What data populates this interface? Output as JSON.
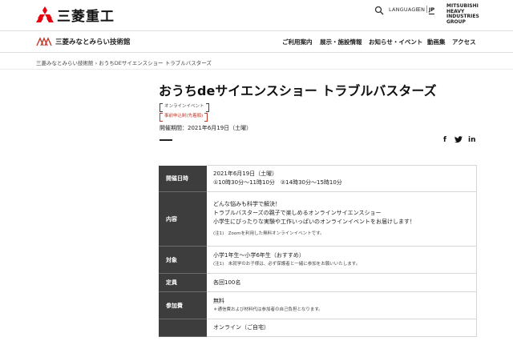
{
  "header": {
    "brand": "三菱重工",
    "language_label": "LANGUAGE :",
    "lang_en": "EN",
    "lang_jp": "JP",
    "group_logo": [
      "MITSUBISHI",
      "HEAVY",
      "INDUSTRIES",
      "GROUP"
    ]
  },
  "nav": {
    "site_name": "三菱みなとみらい技術館",
    "items": [
      "ご利用案内",
      "展示・施設情報",
      "お知らせ・イベント",
      "動画集",
      "アクセス"
    ]
  },
  "breadcrumb": "三菱みなとみらい技術館 › おうちDEサイエンスショー トラブルバスターズ",
  "event": {
    "title": "おうちdeサイエンスショー トラブルバスターズ",
    "tag_online": "オンラインイベント",
    "tag_reserve": "事前申込制(先着順)",
    "period": "開催期間：2021年6月19日（土曜）"
  },
  "share": {
    "facebook": "f",
    "twitter": "t",
    "linkedin": "in"
  },
  "table": {
    "rows": [
      {
        "label": "開催日時",
        "lines": [
          "2021年6月19日（土曜）",
          "①10時30分～11時10分　②14時30分～15時10分"
        ]
      },
      {
        "label": "内容",
        "lines": [
          "どんな悩みも科学で解決！",
          "トラブルバスターズの親子で楽しめるオンラインサイエンスショー",
          "小学生にぴったりな実験や工作いっぱいのオンラインイベントをお届けします！"
        ],
        "note": "(注1)　Zoomを利用した無料オンラインイベントです。"
      },
      {
        "label": "対象",
        "lines": [
          "小学1年生～小学6年生（おすすめ）"
        ],
        "note": "(注1)　未就学のお子様は、必ず保護者と一緒に参加をお願いいたします。"
      },
      {
        "label": "定員",
        "lines": [
          "各回100名"
        ]
      },
      {
        "label": "参加費",
        "lines": [
          "無料"
        ],
        "note": "＊通信費および材料代は参加者の自己負担となります。"
      },
      {
        "label": "",
        "lines": [
          "オンライン（ご自宅）"
        ]
      }
    ]
  },
  "colors": {
    "mitsubishi_red": "#e60012",
    "table_header_bg": "#3d3d3d",
    "reserve_tag": "#c0392b"
  }
}
